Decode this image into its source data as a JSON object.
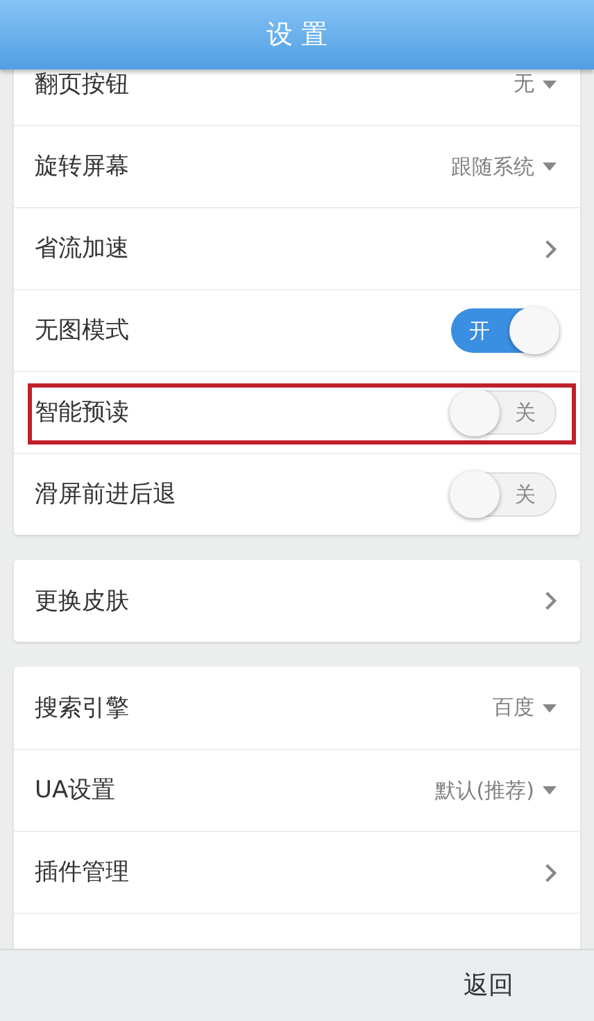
{
  "header": {
    "title": "设 置"
  },
  "groups": [
    {
      "items": [
        {
          "kind": "dropdown",
          "label": "翻页按钮",
          "value": "无"
        },
        {
          "kind": "dropdown",
          "label": "旋转屏幕",
          "value": "跟随系统"
        },
        {
          "kind": "link",
          "label": "省流加速"
        },
        {
          "kind": "toggle",
          "label": "无图模式",
          "on": true,
          "switch_text": "开"
        },
        {
          "kind": "toggle",
          "label": "智能预读",
          "on": false,
          "switch_text": "关",
          "highlighted": true
        },
        {
          "kind": "toggle",
          "label": "滑屏前进后退",
          "on": false,
          "switch_text": "关"
        }
      ]
    },
    {
      "items": [
        {
          "kind": "link",
          "label": "更换皮肤"
        }
      ]
    },
    {
      "items": [
        {
          "kind": "dropdown",
          "label": "搜索引擎",
          "value": "百度"
        },
        {
          "kind": "dropdown",
          "label": "UA设置",
          "value": "默认(推荐)"
        },
        {
          "kind": "link",
          "label": "插件管理"
        }
      ]
    }
  ],
  "footer": {
    "back_button": "返回"
  }
}
